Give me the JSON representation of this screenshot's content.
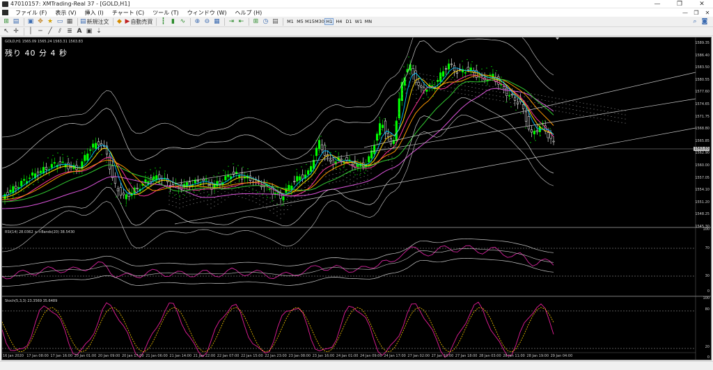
{
  "window": {
    "title": "47010157: XMTrading-Real 37 - [GOLD,H1]",
    "buttons": [
      "—",
      "❐",
      "✕"
    ]
  },
  "menu": {
    "items": [
      "ファイル (F)",
      "表示 (V)",
      "挿入 (I)",
      "チャート (C)",
      "ツール (T)",
      "ウィンドウ (W)",
      "ヘルプ (H)"
    ],
    "mdi_buttons": [
      "—",
      "❐",
      "✕"
    ]
  },
  "toolbar": {
    "new_order_label": "新規注文",
    "auto_trading_label": "自動売買",
    "timeframes": [
      "M1",
      "M5",
      "M15",
      "M30",
      "H1",
      "H4",
      "D1",
      "W1",
      "MN"
    ],
    "active_timeframe": "H1"
  },
  "chart": {
    "main_label": "GOLD,H1  1565.09 1565.24 1563.31 1563.83",
    "countdown": "残り 40 分 4 秒",
    "current_price": "1563.83",
    "price_axis": [
      "1589.35",
      "1586.40",
      "1583.50",
      "1580.55",
      "1577.60",
      "1574.65",
      "1571.75",
      "1568.80",
      "1565.85",
      "1562.90",
      "1560.00",
      "1557.05",
      "1554.10",
      "1551.20",
      "1548.25",
      "1545.30"
    ],
    "rsi_label": "RSI(14) 28.0362  +.+Bands(20) 38.5430",
    "rsi_axis": [
      "100",
      "70",
      "30",
      "0"
    ],
    "stoch_label": "Stoch(5,3,3) 23.3569 35.6489",
    "stoch_axis": [
      "100",
      "80",
      "20",
      "0"
    ],
    "time_axis": [
      "16 Jan 2020",
      "17 Jan 08:00",
      "17 Jan 16:00",
      "20 Jan 01:00",
      "20 Jan 09:00",
      "20 Jan 17:00",
      "21 Jan 06:00",
      "21 Jan 14:00",
      "21 Jan 22:00",
      "22 Jan 07:00",
      "22 Jan 15:00",
      "22 Jan 23:00",
      "23 Jan 08:00",
      "23 Jan 16:00",
      "24 Jan 01:00",
      "24 Jan 09:00",
      "24 Jan 17:00",
      "27 Jan 02:00",
      "27 Jan 10:00",
      "27 Jan 18:00",
      "28 Jan 03:00",
      "28 Jan 11:00",
      "28 Jan 19:00",
      "29 Jan 04:00"
    ]
  },
  "colors": {
    "bull": "#00ff00",
    "bear": "#ffffff",
    "bands": "#d0d0d0",
    "ma_yellow": "#ffd700",
    "ma_cyan": "#00bfff",
    "ma_orange": "#ff9900",
    "ma_green": "#32cd32",
    "ma_pink": "#ff4da6",
    "ma_violet": "#dd66dd",
    "rsi": "#d6249f",
    "stoch_signal": "#ffcc00"
  }
}
